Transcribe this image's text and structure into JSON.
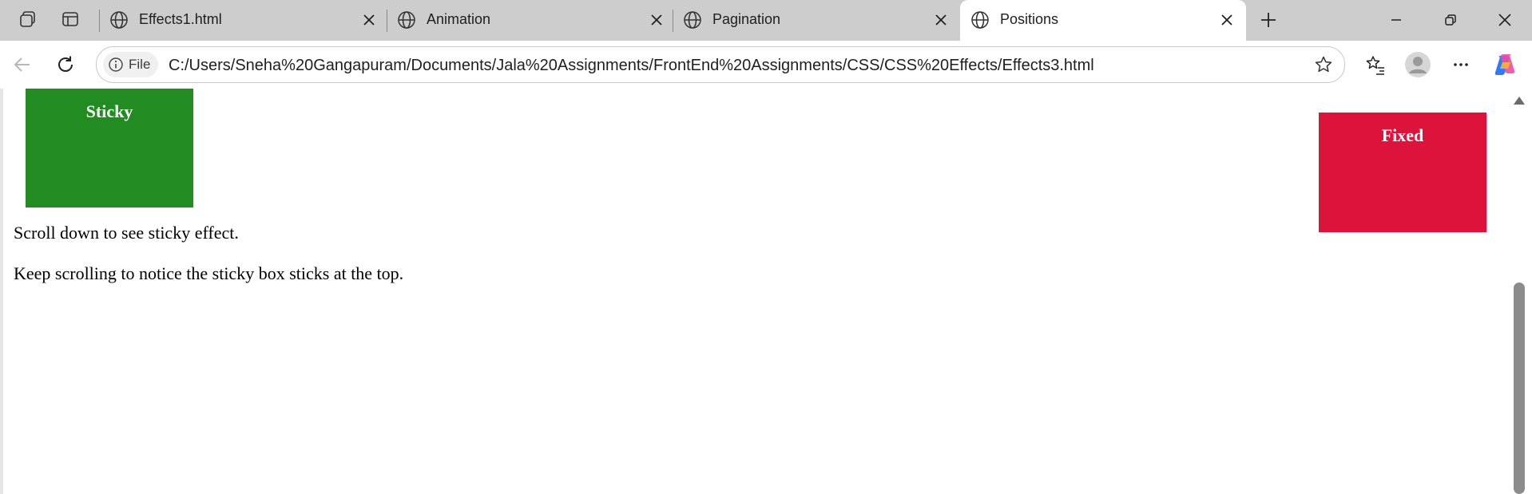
{
  "browser": {
    "tabs": [
      {
        "title": "Effects1.html",
        "active": false
      },
      {
        "title": "Animation",
        "active": false
      },
      {
        "title": "Pagination",
        "active": false
      },
      {
        "title": "Positions",
        "active": true
      }
    ],
    "address": {
      "scheme_label": "File",
      "url": "C:/Users/Sneha%20Gangapuram/Documents/Jala%20Assignments/FrontEnd%20Assignments/CSS/CSS%20Effects/Effects3.html"
    },
    "icons": {
      "workspaces": "workspaces-icon",
      "vertical_tabs": "vertical-tabs-icon",
      "tab_favicon": "globe-icon",
      "close_tab": "close-icon",
      "new_tab": "plus-icon",
      "minimize": "minimize-icon",
      "restore": "restore-icon",
      "close_window": "close-icon",
      "back": "back-arrow-icon",
      "refresh": "refresh-icon",
      "info": "info-icon",
      "favorite": "star-icon",
      "favorites": "favorites-icon",
      "profile": "profile-avatar-icon",
      "menu": "more-icon",
      "copilot": "copilot-icon"
    }
  },
  "page": {
    "sticky_label": "Sticky",
    "fixed_label": "Fixed",
    "paragraphs": [
      "Scroll down to see sticky effect.",
      "Keep scrolling to notice the sticky box sticks at the top."
    ],
    "colors": {
      "sticky_box": "#228B22",
      "fixed_box": "#DC143C"
    }
  }
}
